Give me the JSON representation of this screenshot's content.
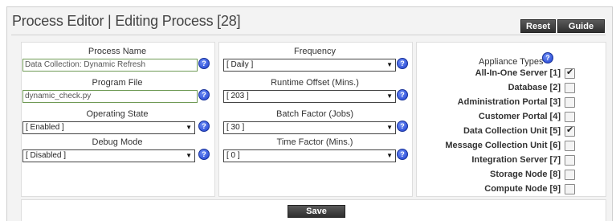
{
  "header": {
    "title": "Process Editor | Editing Process [28]",
    "reset_label": "Reset",
    "guide_label": "Guide"
  },
  "left": {
    "process_name_label": "Process Name",
    "process_name_value": "Data Collection: Dynamic Refresh",
    "program_file_label": "Program File",
    "program_file_value": "dynamic_check.py",
    "operating_state_label": "Operating State",
    "operating_state_value": "[ Enabled ]",
    "debug_mode_label": "Debug Mode",
    "debug_mode_value": "[ Disabled ]"
  },
  "middle": {
    "frequency_label": "Frequency",
    "frequency_value": "[ Daily ]",
    "runtime_offset_label": "Runtime Offset (Mins.)",
    "runtime_offset_value": "[ 203 ]",
    "batch_factor_label": "Batch Factor (Jobs)",
    "batch_factor_value": "[ 30 ]",
    "time_factor_label": "Time Factor (Mins.)",
    "time_factor_value": "[ 0 ]"
  },
  "appliance": {
    "title": "Appliance Types",
    "items": [
      {
        "label": "All-In-One Server [1]",
        "checked": true
      },
      {
        "label": "Database [2]",
        "checked": false
      },
      {
        "label": "Administration Portal [3]",
        "checked": false
      },
      {
        "label": "Customer Portal [4]",
        "checked": false
      },
      {
        "label": "Data Collection Unit [5]",
        "checked": true
      },
      {
        "label": "Message Collection Unit [6]",
        "checked": false
      },
      {
        "label": "Integration Server [7]",
        "checked": false
      },
      {
        "label": "Storage Node [8]",
        "checked": false
      },
      {
        "label": "Compute Node [9]",
        "checked": false
      }
    ]
  },
  "footer": {
    "save_label": "Save"
  },
  "icons": {
    "help": "question-mark-help-icon",
    "dropdown": "triangle-down-icon",
    "check": "checkmark-icon"
  },
  "colors": {
    "button_bg": "#3a3a3a",
    "field_border": "#6f9a55",
    "help_icon": "#1e3fd0"
  }
}
